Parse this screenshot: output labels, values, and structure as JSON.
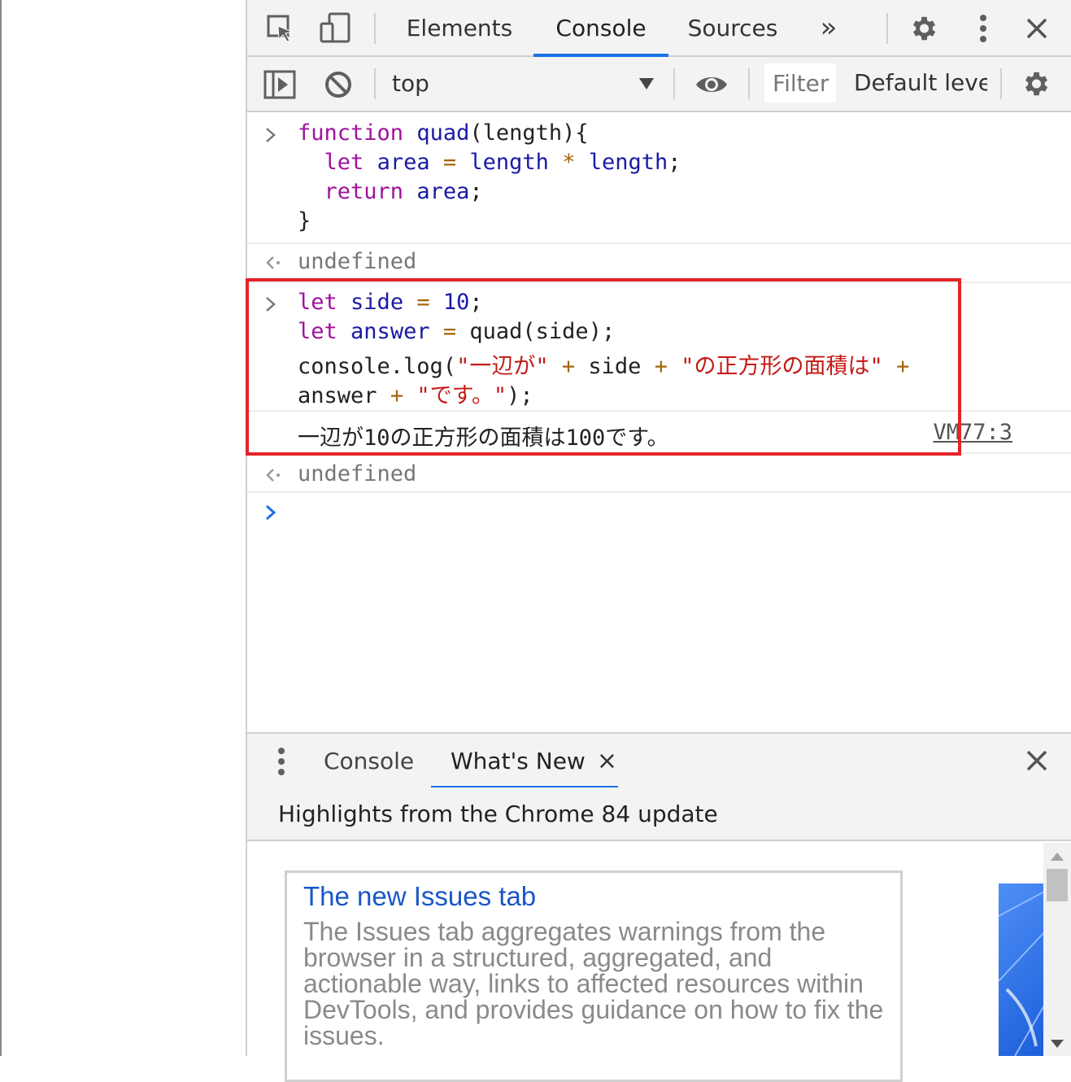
{
  "devtools": {
    "tabs": [
      {
        "label": "Elements"
      },
      {
        "label": "Console"
      },
      {
        "label": "Sources"
      }
    ],
    "more_tabs": "»",
    "close": "×"
  },
  "toolbar": {
    "context": "top",
    "filter_placeholder": "Filter",
    "level": "Default levels"
  },
  "console": {
    "entry1": {
      "l1": {
        "kw": "function",
        "name": "quad",
        "rest": "(length){"
      },
      "l2": {
        "kw": "let",
        "var": "area",
        "eq": "=",
        "a": "length",
        "op": "*",
        "b": "length",
        "end": ";"
      },
      "l3": {
        "kw": "return",
        "var": "area",
        "end": ";"
      },
      "l4": "}"
    },
    "result1": "undefined",
    "entry2": {
      "l1": {
        "kw": "let",
        "var": "side",
        "eq": "=",
        "num": "10",
        "end": ";"
      },
      "l2": {
        "kw": "let",
        "var": "answer",
        "eq": "=",
        "rest": "quad(side);"
      },
      "l3": {
        "pre": "console.log(",
        "s1": "\"一辺が\"",
        "p1": "+",
        "mid": "side",
        "p2": "+",
        "s2": "\"の正方形の面積は\"",
        "p3": "+"
      },
      "l4": {
        "pre": "answer",
        "p1": "+",
        "s1": "\"です。\"",
        "end": ");"
      }
    },
    "log_output": "一辺が10の正方形の面積は100です。",
    "log_source": "VM77:3",
    "result2": "undefined"
  },
  "drawer": {
    "tabs": [
      {
        "label": "Console"
      },
      {
        "label": "What's New"
      }
    ],
    "tab_close": "×",
    "close": "×",
    "header": "Highlights from the Chrome 84 update",
    "card": {
      "title": "The new Issues tab",
      "text": "The Issues tab aggregates warnings from the browser in a structured, aggregated, and actionable way, links to affected resources within DevTools, and provides guidance on how to fix the issues."
    }
  }
}
